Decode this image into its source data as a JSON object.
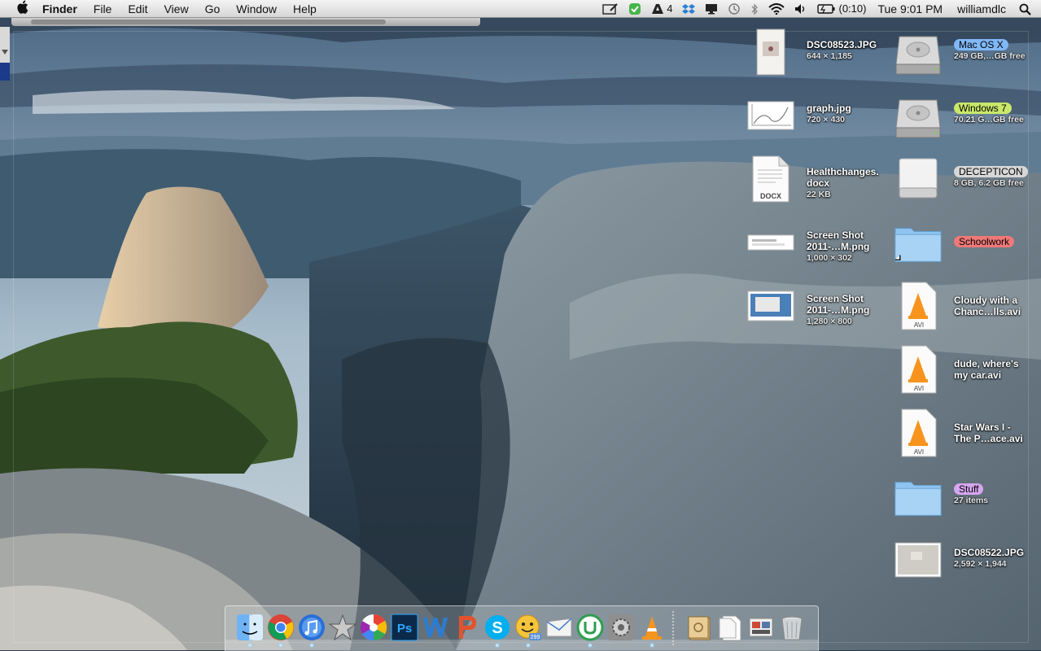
{
  "menubar": {
    "apple_icon": "apple-icon",
    "app_name": "Finder",
    "menus": [
      "File",
      "Edit",
      "View",
      "Go",
      "Window",
      "Help"
    ],
    "status": {
      "adobe_count": "4",
      "battery_time": "(0:10)",
      "clock": "Tue 9:01 PM",
      "user": "williamdlc"
    }
  },
  "desktop_files": [
    {
      "name": "DSC08523.JPG",
      "info": "644 × 1,185"
    },
    {
      "name": "graph.jpg",
      "info": "720 × 430"
    },
    {
      "name_line1": "Healthchanges.",
      "name_line2": "docx",
      "info": "22 KB",
      "badge": "DOCX"
    },
    {
      "name_line1": "Screen Shot",
      "name_line2": "2011-…M.png",
      "info": "1,000 × 302"
    },
    {
      "name_line1": "Screen Shot",
      "name_line2": "2011-…M.png",
      "info": "1,280 × 800"
    }
  ],
  "desktop_right": [
    {
      "name": "Mac OS X",
      "info": "249 GB,…GB free",
      "tag_color": "#7fb8f5"
    },
    {
      "name": "Windows 7",
      "info": "70.21 G…GB free",
      "tag_color": "#c9e86a"
    },
    {
      "name": "DECEPTICON",
      "info": "8 GB, 6.2 GB free",
      "tag_color": "#d7d7d7"
    },
    {
      "name": "Schoolwork",
      "tag_color": "#f07878"
    },
    {
      "name_line1": "Cloudy with a",
      "name_line2": "Chanc…lls.avi",
      "badge": "AVI"
    },
    {
      "name_line1": "dude, where's",
      "name_line2": "my car.avi",
      "badge": "AVI"
    },
    {
      "name_line1": "Star Wars I -",
      "name_line2": "The P…ace.avi",
      "badge": "AVI"
    },
    {
      "name": "Stuff",
      "info": "27 items",
      "tag_color": "#d6a6f0"
    },
    {
      "name": "DSC08522.JPG",
      "info": "2,592 × 1,944"
    }
  ],
  "dock": {
    "apps": [
      "Finder",
      "Google Chrome",
      "iTunes",
      "iMovie",
      "Picasa",
      "Photoshop",
      "Word",
      "PowerPoint",
      "Skype",
      "Adium",
      "Mail",
      "uTorrent",
      "System Preferences",
      "VLC"
    ],
    "right": [
      "Applications",
      "Documents",
      "Downloads",
      "Trash"
    ],
    "mail_badge": "299"
  }
}
